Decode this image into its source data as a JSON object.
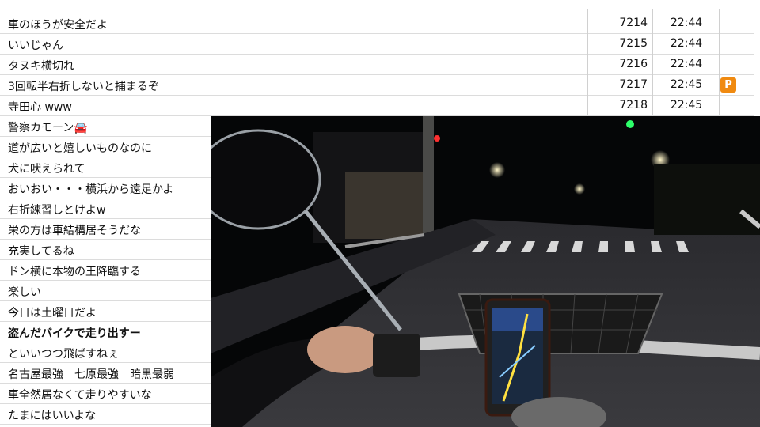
{
  "comments": [
    {
      "text": "車のほうが安全だよ",
      "number": "7214",
      "time": "22:44",
      "premium": ""
    },
    {
      "text": "いいじゃん",
      "number": "7215",
      "time": "22:44",
      "premium": ""
    },
    {
      "text": "タヌキ横切れ",
      "number": "7216",
      "time": "22:44",
      "premium": ""
    },
    {
      "text": "3回転半右折しないと捕まるぞ",
      "number": "7217",
      "time": "22:45",
      "premium": "P"
    },
    {
      "text": "寺田心 www",
      "number": "7218",
      "time": "22:45",
      "premium": ""
    },
    {
      "text": "警察カモーン🚘",
      "number": "",
      "time": "",
      "premium": ""
    },
    {
      "text": "道が広いと嬉しいものなのに",
      "number": "",
      "time": "",
      "premium": ""
    },
    {
      "text": "犬に吠えられて",
      "number": "",
      "time": "",
      "premium": ""
    },
    {
      "text": "おいおい・・・横浜から遠足かよ",
      "number": "",
      "time": "",
      "premium": ""
    },
    {
      "text": "右折練習しとけよw",
      "number": "",
      "time": "",
      "premium": ""
    },
    {
      "text": "栄の方は車結構居そうだな",
      "number": "",
      "time": "",
      "premium": ""
    },
    {
      "text": "充実してるね",
      "number": "",
      "time": "",
      "premium": ""
    },
    {
      "text": "ドン横に本物の王降臨する",
      "number": "",
      "time": "",
      "premium": ""
    },
    {
      "text": "楽しい",
      "number": "",
      "time": "",
      "premium": ""
    },
    {
      "text": "今日は土曜日だよ",
      "number": "",
      "time": "",
      "premium": ""
    },
    {
      "text": "盗んだバイクで走り出すー",
      "number": "",
      "time": "",
      "premium": "",
      "bold": true
    },
    {
      "text": "といいつつ飛ばすねぇ",
      "number": "",
      "time": "",
      "premium": ""
    },
    {
      "text": "名古屋最強　七原最強　暗黒最弱",
      "number": "",
      "time": "",
      "premium": ""
    },
    {
      "text": "車全然居なくて走りやすいな",
      "number": "",
      "time": "",
      "premium": ""
    },
    {
      "text": "たまにはいいよな",
      "number": "",
      "time": "",
      "premium": ""
    }
  ],
  "colors": {
    "premium_badge": "#f08a10",
    "grid_line": "#dcdcdc",
    "night_sky": "#050607",
    "green_signal": "#2dff6a",
    "red_signal": "#ff3030",
    "phone_screen": "#1a2a40"
  },
  "video": {
    "description_icons": [
      "side-mirror",
      "handlebar",
      "basket",
      "smartphone-navigation",
      "rider-hand"
    ]
  }
}
